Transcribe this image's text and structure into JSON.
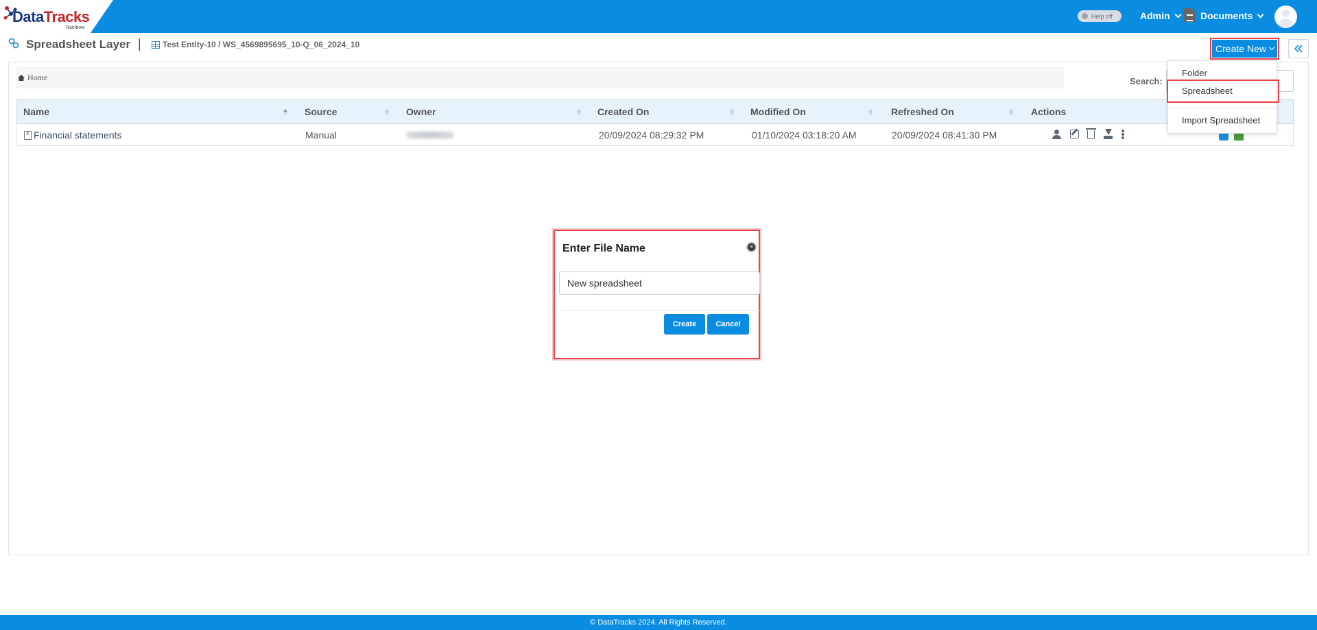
{
  "brand": {
    "name_part1": "Data",
    "name_part2": "Tracks",
    "sub": "Rainbow"
  },
  "topnav": {
    "help_toggle": "Help off",
    "admin": "Admin",
    "documents": "Documents"
  },
  "header": {
    "title": "Spreadsheet Layer",
    "separator": "|",
    "path": "Test Entity-10 / WS_4569895695_10-Q_06_2024_10",
    "create_new": "Create New"
  },
  "breadcrumb": {
    "home": "Home"
  },
  "search": {
    "label": "Search:",
    "value": ""
  },
  "table": {
    "columns": [
      "Name",
      "Source",
      "Owner",
      "Created On",
      "Modified On",
      "Refreshed On",
      "Actions"
    ],
    "rows": [
      {
        "name": "Financial statements",
        "source": "Manual",
        "owner": "",
        "created": "20/09/2024 08:29:32 PM",
        "modified": "01/10/2024 03:18:20 AM",
        "refreshed": "20/09/2024 08:41:30 PM"
      }
    ]
  },
  "dropdown": {
    "items": [
      "Folder",
      "Spreadsheet",
      "Import Spreadsheet"
    ],
    "highlighted": "Spreadsheet"
  },
  "modal": {
    "title": "Enter File Name",
    "input_value": "New spreadsheet",
    "create_label": "Create",
    "cancel_label": "Cancel",
    "close_glyph": "×"
  },
  "footer": {
    "text": "© DataTracks 2024. All Rights Reserved."
  },
  "colors": {
    "primary": "#0a8de0",
    "highlight": "#e8414a",
    "header_bg": "#e8f2fb"
  }
}
